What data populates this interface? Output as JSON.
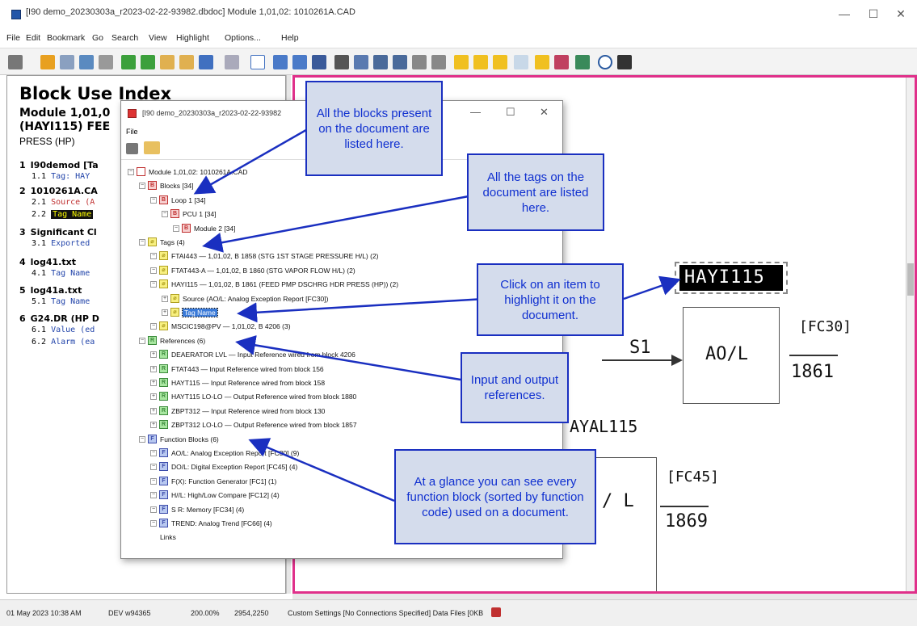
{
  "window": {
    "title": "[I90 demo_20230303a_r2023-02-22-93982.dbdoc] Module 1,01,02: 1010261A.CAD",
    "minimize": "—",
    "maximize": "☐",
    "close": "✕"
  },
  "menu": [
    "File",
    "Edit",
    "Bookmark",
    "Go",
    "Search",
    "View",
    "Highlight",
    "Options...",
    "Help"
  ],
  "left": {
    "heading": "Block Use Index",
    "subheading1": "Module 1,01,0",
    "subheading2": "(HAYI115) FEE",
    "subheading3": "PRESS (HP)",
    "items": [
      {
        "num": "1",
        "text": "I90demod [Ta"
      },
      {
        "num": "1.1",
        "text": "Tag: HAY"
      },
      {
        "num": "2",
        "text": "1010261A.CA"
      },
      {
        "num": "2.1",
        "text": "Source (A"
      },
      {
        "num": "2.2",
        "text": "Tag Name"
      },
      {
        "num": "3",
        "text": "Significant Cl"
      },
      {
        "num": "3.1",
        "text": "Exported"
      },
      {
        "num": "4",
        "text": "log41.txt"
      },
      {
        "num": "4.1",
        "text": "Tag Name"
      },
      {
        "num": "5",
        "text": "log41a.txt"
      },
      {
        "num": "5.1",
        "text": "Tag Name"
      },
      {
        "num": "6",
        "text": "G24.DR (HP D"
      },
      {
        "num": "6.1",
        "text": "Value (ed"
      },
      {
        "num": "6.2",
        "text": "Alarm (ea"
      }
    ]
  },
  "drawing": {
    "tag": "HAYI115",
    "fc30": "[FC30]",
    "block1": "AO/L",
    "num1": "1861",
    "s1": "S1",
    "ayal": "AYAL115",
    "fc45": "[FC45]",
    "block2_partial": "/ L",
    "num2": "1869"
  },
  "dialog": {
    "title": "[I90 demo_20230303a_r2023-02-22-93982",
    "menu_file": "File",
    "tree": [
      {
        "label": "Module 1,01,02: 1010261A.CAD",
        "indent": 0,
        "icon": "module"
      },
      {
        "label": "Blocks [34]",
        "indent": 1,
        "icon": "B"
      },
      {
        "label": "Loop 1 [34]",
        "indent": 2,
        "icon": "B"
      },
      {
        "label": "PCU 1 [34]",
        "indent": 3,
        "icon": "B"
      },
      {
        "label": "Module 2 [34]",
        "indent": 4,
        "icon": "B"
      },
      {
        "label": "Tags (4)",
        "indent": 1,
        "icon": "tag"
      },
      {
        "label": "FTAI443 — 1,01,02, B 1858 (STG 1ST STAGE   PRESSURE H/L) (2)",
        "indent": 2,
        "icon": "tag"
      },
      {
        "label": "FTAT443-A — 1,01,02, B 1860 (STG VAPOR       FLOW H/L) (2)",
        "indent": 2,
        "icon": "tag"
      },
      {
        "label": "HAYI115 — 1,01,02, B 1861 (FEED PMP DSCHRG HDR PRESS (HP)) (2)",
        "indent": 2,
        "icon": "tag"
      },
      {
        "label": "Source (AO/L: Analog Exception Report [FC30])",
        "indent": 3,
        "icon": "tag"
      },
      {
        "label": "Tag Name",
        "indent": 3,
        "icon": "tag",
        "selected": true
      },
      {
        "label": "MSCIC198@PV — 1,01,02, B 4206 (3)",
        "indent": 2,
        "icon": "tag"
      },
      {
        "label": "References (6)",
        "indent": 1,
        "icon": "ref"
      },
      {
        "label": "DEAERATOR LVL — Input Reference wired from block 4206",
        "indent": 2,
        "icon": "ref"
      },
      {
        "label": "FTAT443 — Input Reference wired from block 156",
        "indent": 2,
        "icon": "ref"
      },
      {
        "label": "HAYT115 — Input Reference wired from block 158",
        "indent": 2,
        "icon": "ref"
      },
      {
        "label": "HAYT115 LO-LO — Output Reference wired from block 1880",
        "indent": 2,
        "icon": "ref"
      },
      {
        "label": "ZBPT312 — Input Reference wired from block 130",
        "indent": 2,
        "icon": "ref"
      },
      {
        "label": "ZBPT312 LO-LO — Output Reference wired from block 1857",
        "indent": 2,
        "icon": "ref"
      },
      {
        "label": "Function Blocks (6)",
        "indent": 1,
        "icon": "fb"
      },
      {
        "label": "AO/L: Analog Exception Report [FC30] (9)",
        "indent": 2,
        "icon": "fb"
      },
      {
        "label": "DO/L: Digital Exception Report [FC45] (4)",
        "indent": 2,
        "icon": "fb"
      },
      {
        "label": "F(X): Function Generator [FC1] (1)",
        "indent": 2,
        "icon": "fb"
      },
      {
        "label": "H//L: High/Low Compare [FC12] (4)",
        "indent": 2,
        "icon": "fb"
      },
      {
        "label": "S R: Memory [FC34] (4)",
        "indent": 2,
        "icon": "fb"
      },
      {
        "label": "TREND: Analog Trend [FC66] (4)",
        "indent": 2,
        "icon": "fb"
      },
      {
        "label": "Links",
        "indent": 1,
        "icon": "link"
      }
    ]
  },
  "callouts": {
    "c1": "All the blocks present on the document are listed here.",
    "c2": "All the tags on the document are listed here.",
    "c3": "Click on an item to highlight it on the document.",
    "c4": "Input and output references.",
    "c5": "At a glance you can see every function block (sorted by function code) used on a document."
  },
  "status": {
    "date": "01 May 2023 10:38 AM",
    "dev": "DEV w94365",
    "zoom": "200.00%",
    "coords": "2954,2250",
    "settings": "Custom Settings [No Connections Specified] Data Files [0KB"
  },
  "colors": {
    "callout_border": "#1a2fc0",
    "callout_fill": "#d4dcec",
    "pane_border": "#e0308a",
    "arrow": "#1a2fc0"
  }
}
